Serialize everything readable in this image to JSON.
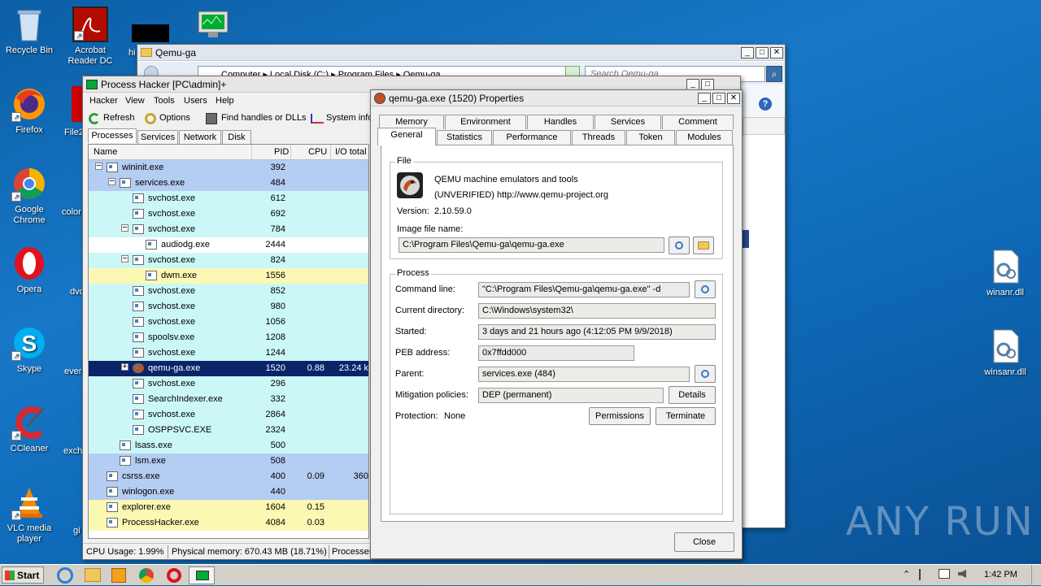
{
  "desktop": {
    "icons": [
      {
        "label": "Recycle Bin"
      },
      {
        "label": "Acrobat Reader DC"
      },
      {
        "label": "Firefox"
      },
      {
        "label": "Google Chrome"
      },
      {
        "label": "Opera"
      },
      {
        "label": "Skype"
      },
      {
        "label": "CCleaner"
      },
      {
        "label": "VLC media player"
      },
      {
        "label": "winanr.dll"
      },
      {
        "label": "winsanr.dll"
      }
    ],
    "partial_labels": [
      "hi",
      "File2",
      "color",
      "dvd",
      "ever",
      "exch",
      "gi"
    ],
    "watermark": "ANY RUN"
  },
  "explorer": {
    "title": "Qemu-ga",
    "address": "Computer  ▸  Local Disk (C:)  ▸  Program Files  ▸  Qemu-ga",
    "search_placeholder": "Search Qemu-ga"
  },
  "process_hacker": {
    "title": "Process Hacker [PC\\admin]+",
    "menu": [
      "Hacker",
      "View",
      "Tools",
      "Users",
      "Help"
    ],
    "toolbar": {
      "refresh": "Refresh",
      "options": "Options",
      "find": "Find handles or DLLs",
      "sysinfo": "System info"
    },
    "tabs": [
      "Processes",
      "Services",
      "Network",
      "Disk"
    ],
    "columns": [
      "Name",
      "PID",
      "CPU",
      "I/O total"
    ],
    "rows": [
      {
        "name": "wininit.exe",
        "pid": "392",
        "cpu": "",
        "io": "",
        "indent": 0,
        "exp": "−",
        "bg": "#b4cdf2"
      },
      {
        "name": "services.exe",
        "pid": "484",
        "cpu": "",
        "io": "",
        "indent": 1,
        "exp": "−",
        "bg": "#b4cdf2"
      },
      {
        "name": "svchost.exe",
        "pid": "612",
        "cpu": "",
        "io": "",
        "indent": 2,
        "exp": "",
        "bg": "#ccf7f7"
      },
      {
        "name": "svchost.exe",
        "pid": "692",
        "cpu": "",
        "io": "",
        "indent": 2,
        "exp": "",
        "bg": "#ccf7f7"
      },
      {
        "name": "svchost.exe",
        "pid": "784",
        "cpu": "",
        "io": "",
        "indent": 2,
        "exp": "−",
        "bg": "#ccf7f7"
      },
      {
        "name": "audiodg.exe",
        "pid": "2444",
        "cpu": "",
        "io": "",
        "indent": 3,
        "exp": "",
        "bg": "#ffffff"
      },
      {
        "name": "svchost.exe",
        "pid": "824",
        "cpu": "",
        "io": "",
        "indent": 2,
        "exp": "−",
        "bg": "#ccf7f7"
      },
      {
        "name": "dwm.exe",
        "pid": "1556",
        "cpu": "",
        "io": "",
        "indent": 3,
        "exp": "",
        "bg": "#fbf8b4"
      },
      {
        "name": "svchost.exe",
        "pid": "852",
        "cpu": "",
        "io": "",
        "indent": 2,
        "exp": "",
        "bg": "#ccf7f7"
      },
      {
        "name": "svchost.exe",
        "pid": "980",
        "cpu": "",
        "io": "",
        "indent": 2,
        "exp": "",
        "bg": "#ccf7f7"
      },
      {
        "name": "svchost.exe",
        "pid": "1056",
        "cpu": "",
        "io": "",
        "indent": 2,
        "exp": "",
        "bg": "#ccf7f7"
      },
      {
        "name": "spoolsv.exe",
        "pid": "1208",
        "cpu": "",
        "io": "",
        "indent": 2,
        "exp": "",
        "bg": "#ccf7f7"
      },
      {
        "name": "svchost.exe",
        "pid": "1244",
        "cpu": "",
        "io": "",
        "indent": 2,
        "exp": "",
        "bg": "#ccf7f7"
      },
      {
        "name": "qemu-ga.exe",
        "pid": "1520",
        "cpu": "0.88",
        "io": "23.24 k",
        "indent": 2,
        "exp": "+",
        "bg": "#0a246a",
        "selected": true
      },
      {
        "name": "svchost.exe",
        "pid": "296",
        "cpu": "",
        "io": "",
        "indent": 2,
        "exp": "",
        "bg": "#ccf7f7"
      },
      {
        "name": "SearchIndexer.exe",
        "pid": "332",
        "cpu": "",
        "io": "",
        "indent": 2,
        "exp": "",
        "bg": "#ccf7f7"
      },
      {
        "name": "svchost.exe",
        "pid": "2864",
        "cpu": "",
        "io": "",
        "indent": 2,
        "exp": "",
        "bg": "#ccf7f7"
      },
      {
        "name": "OSPPSVC.EXE",
        "pid": "2324",
        "cpu": "",
        "io": "",
        "indent": 2,
        "exp": "",
        "bg": "#ccf7f7"
      },
      {
        "name": "lsass.exe",
        "pid": "500",
        "cpu": "",
        "io": "",
        "indent": 1,
        "exp": "",
        "bg": "#ccf7f7"
      },
      {
        "name": "lsm.exe",
        "pid": "508",
        "cpu": "",
        "io": "",
        "indent": 1,
        "exp": "",
        "bg": "#b4cdf2"
      },
      {
        "name": "csrss.exe",
        "pid": "400",
        "cpu": "0.09",
        "io": "360",
        "indent": 0,
        "exp": "",
        "bg": "#b4cdf2"
      },
      {
        "name": "winlogon.exe",
        "pid": "440",
        "cpu": "",
        "io": "",
        "indent": 0,
        "exp": "",
        "bg": "#b4cdf2"
      },
      {
        "name": "explorer.exe",
        "pid": "1604",
        "cpu": "0.15",
        "io": "",
        "indent": 0,
        "exp": "",
        "bg": "#fbf8b4"
      },
      {
        "name": "ProcessHacker.exe",
        "pid": "4084",
        "cpu": "0.03",
        "io": "",
        "indent": 0,
        "exp": "",
        "bg": "#fbf8b4"
      }
    ],
    "status": {
      "cpu": "CPU Usage: 1.99%",
      "memory": "Physical memory: 670.43 MB (18.71%)",
      "processes": "Processes"
    }
  },
  "properties": {
    "title": "qemu-ga.exe (1520) Properties",
    "tabs_row1": [
      "Memory",
      "Environment",
      "Handles",
      "Services",
      "Comment"
    ],
    "tabs_row2": [
      "General",
      "Statistics",
      "Performance",
      "Threads",
      "Token",
      "Modules"
    ],
    "file_group": "File",
    "description": "QEMU machine emulators and tools",
    "company": "(UNVERIFIED) http://www.qemu-project.org",
    "version_label": "Version:",
    "version": "2.10.59.0",
    "image_label": "Image file name:",
    "image_path": "C:\\Program Files\\Qemu-ga\\qemu-ga.exe",
    "process_group": "Process",
    "cmd_label": "Command line:",
    "cmd": "\"C:\\Program Files\\Qemu-ga\\qemu-ga.exe\" -d",
    "cwd_label": "Current directory:",
    "cwd": "C:\\Windows\\system32\\",
    "started_label": "Started:",
    "started": "3 days and 21 hours ago (4:12:05 PM 9/9/2018)",
    "peb_label": "PEB address:",
    "peb": "0x7ffdd000",
    "parent_label": "Parent:",
    "parent": "services.exe (484)",
    "mitigation_label": "Mitigation policies:",
    "mitigation": "DEP (permanent)",
    "details_btn": "Details",
    "protection_label": "Protection:",
    "protection": "None",
    "permissions_btn": "Permissions",
    "terminate_btn": "Terminate",
    "close_btn": "Close"
  },
  "taskbar": {
    "start": "Start",
    "clock": "1:42 PM"
  }
}
